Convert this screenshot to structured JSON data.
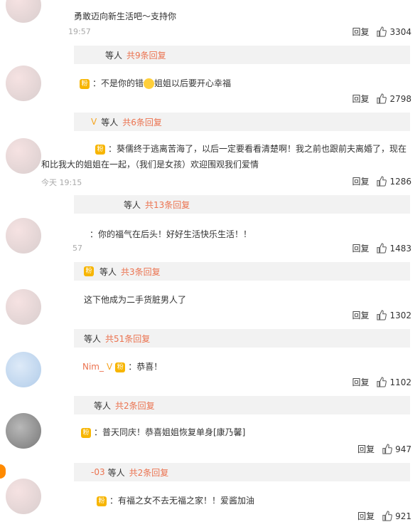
{
  "comments": [
    {
      "text": "勇敢迈向新生活吧～支持你",
      "time": "19:57",
      "reply_label": "回复",
      "likes": "3304"
    },
    {
      "replies_label": "等人",
      "replies_count": "共9条回复"
    },
    {
      "text": "：不是你的错",
      "text_after_emoji": "姐姐以后要开心幸福",
      "reply_label": "回复",
      "likes": "2798"
    },
    {
      "replies_label": "等人",
      "replies_count": "共6条回复"
    },
    {
      "text": "：葵儒终于逃离苦海了，以后一定要看看清楚啊！我之前也跟前夫离婚了，现在和比我大的姐姐在一起，（我们是女孩）欢迎围观我们爱情",
      "time": "今天 19:15",
      "reply_label": "回复",
      "likes": "1286"
    },
    {
      "replies_label": "等人",
      "replies_count": "共13条回复"
    },
    {
      "text": "：你的福气在后头！好好生活快乐生活！！",
      "time": "57",
      "reply_label": "回复",
      "likes": "1483"
    },
    {
      "replies_label": "等人",
      "replies_count": "共3条回复"
    },
    {
      "text": "这下他成为二手货脏男人了",
      "reply_label": "回复",
      "likes": "1302"
    },
    {
      "replies_label": "等人",
      "replies_count": "共51条回复"
    },
    {
      "name": "Nim_",
      "text": "：恭喜！",
      "reply_label": "回复",
      "likes": "1102"
    },
    {
      "replies_label": "等人",
      "replies_count": "共2条回复"
    },
    {
      "text": "：普天同庆！恭喜姐姐恢复单身[康乃馨]",
      "reply_label": "回复",
      "likes": "947"
    },
    {
      "name": "-03",
      "replies_label": "等人",
      "replies_count": "共2条回复"
    },
    {
      "text": "：有福之女不去无福之家！！爱酱加油",
      "reply_label": "回复",
      "likes": "921"
    }
  ],
  "icons": {
    "like": "thumb-up-icon",
    "vip": "vip-badge-icon",
    "fan": "fan-badge-icon",
    "emoji": "crying-emoji-icon"
  },
  "colors": {
    "accent": "#eb7350",
    "reply_bg": "#f2f2f2",
    "time": "#aaaaaa"
  }
}
